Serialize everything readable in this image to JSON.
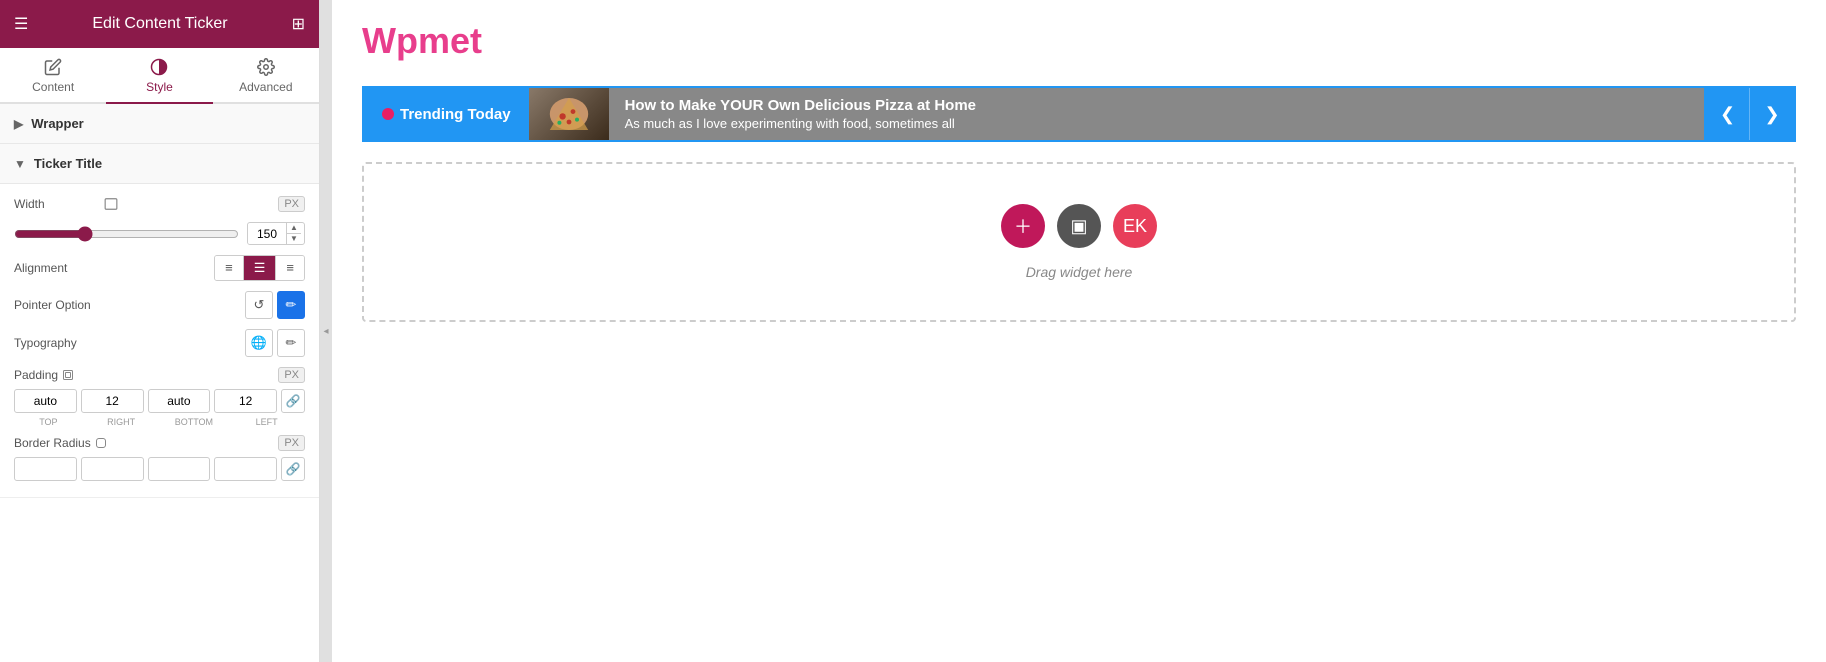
{
  "header": {
    "title": "Edit Content Ticker",
    "menu_icon": "☰",
    "grid_icon": "⊞"
  },
  "tabs": [
    {
      "id": "content",
      "label": "Content",
      "icon": "✏️",
      "active": false
    },
    {
      "id": "style",
      "label": "Style",
      "icon": "◐",
      "active": true
    },
    {
      "id": "advanced",
      "label": "Advanced",
      "icon": "⚙️",
      "active": false
    }
  ],
  "sidebar": {
    "sections": [
      {
        "id": "wrapper",
        "label": "Wrapper",
        "collapsed": true
      },
      {
        "id": "ticker-title",
        "label": "Ticker Title",
        "collapsed": false,
        "fields": {
          "width_label": "Width",
          "width_value": "150",
          "width_unit": "PX",
          "alignment_label": "Alignment",
          "pointer_label": "Pointer Option",
          "typography_label": "Typography",
          "padding_label": "Padding",
          "padding_unit": "PX",
          "padding_top": "auto",
          "padding_right": "12",
          "padding_bottom": "auto",
          "padding_left": "12",
          "padding_sub_top": "TOP",
          "padding_sub_right": "RIGHT",
          "padding_sub_bottom": "BOTTOM",
          "padding_sub_left": "LEFT",
          "border_radius_label": "Border Radius",
          "border_radius_unit": "PX"
        }
      }
    ]
  },
  "main": {
    "site_title": "Wpmet",
    "ticker": {
      "label_text": "Trending Today",
      "title": "How to Make YOUR Own Delicious Pizza at Home",
      "subtitle": "As much as I love experimenting with food, sometimes all",
      "nav_prev": "❮",
      "nav_next": "❯"
    },
    "dropzone": {
      "text": "Drag widget here"
    }
  }
}
